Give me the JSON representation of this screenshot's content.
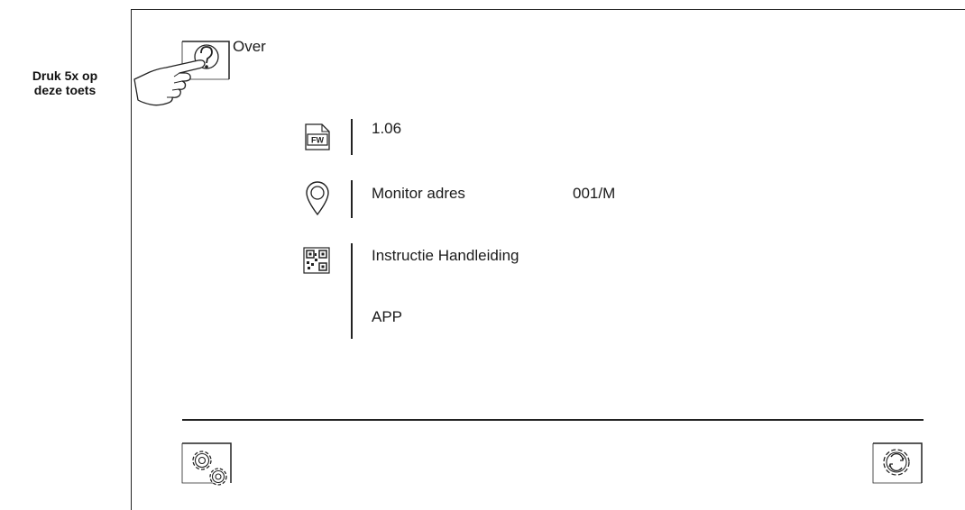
{
  "annotation": {
    "press_hint_line1": "Druk 5x op",
    "press_hint_line2": "deze toets"
  },
  "header": {
    "title": "Over",
    "icon": "question-mark-icon"
  },
  "firmware": {
    "icon": "fw-icon",
    "icon_label": "FW",
    "version": "1.06"
  },
  "address": {
    "icon": "location-pin-icon",
    "label": "Monitor adres",
    "value": "001/M"
  },
  "qr": {
    "icon": "qr-code-icon",
    "manual_label": "Instructie Handleiding",
    "app_label": "APP"
  },
  "footer": {
    "left_icon": "settings-gears-icon",
    "right_icon": "refresh-gear-icon"
  }
}
